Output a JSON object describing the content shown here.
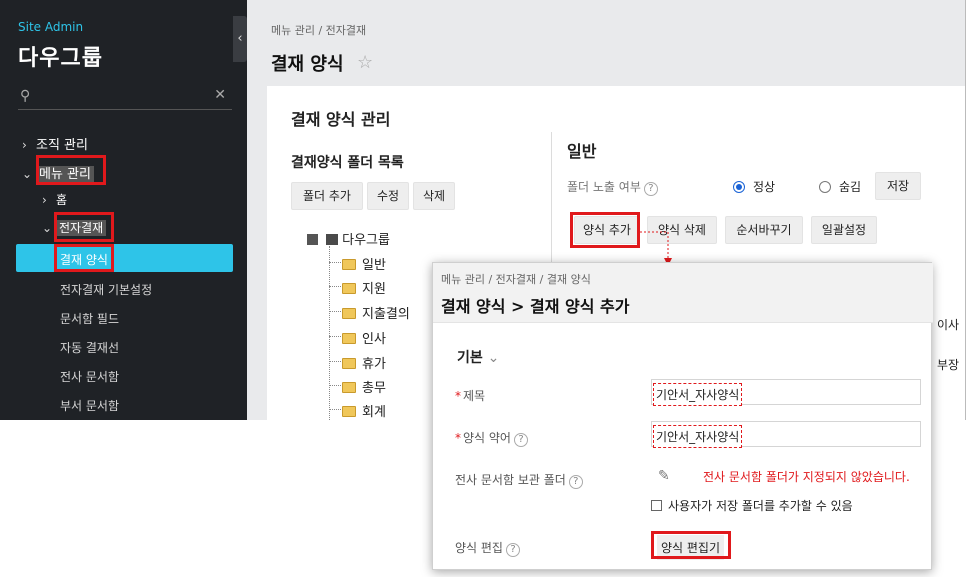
{
  "sidebar": {
    "site_label": "Site Admin",
    "company": "다우그룹",
    "search_placeholder": "",
    "menu": [
      {
        "label": "조직 관리"
      },
      {
        "label": "메뉴 관리"
      },
      {
        "label": "홈"
      },
      {
        "label": "전자결재"
      }
    ],
    "submenu": [
      {
        "label": "결재 양식",
        "active": true
      },
      {
        "label": "전자결재 기본설정"
      },
      {
        "label": "문서함 필드"
      },
      {
        "label": "자동 결재선"
      },
      {
        "label": "전사 문서함"
      },
      {
        "label": "부서 문서함"
      }
    ]
  },
  "header": {
    "breadcrumb": "메뉴 관리 / 전자결재",
    "title": "결재 양식"
  },
  "panel": {
    "title": "결재 양식 관리",
    "folder_list_title": "결재양식 폴더 목록",
    "folder_buttons": [
      "폴더 추가",
      "수정",
      "삭제"
    ],
    "tree_root": "다우그룹",
    "tree_items": [
      "일반",
      "지원",
      "지출결의",
      "인사",
      "휴가",
      "총무",
      "회계"
    ],
    "general_title": "일반",
    "folder_visibility_label": "폴더 노출 여부",
    "radio_normal": "정상",
    "radio_hidden": "숨김",
    "save_button": "저장",
    "form_buttons": [
      "양식 추가",
      "양식 삭제",
      "순서바꾸기",
      "일괄설정"
    ],
    "right_peek": [
      "이사",
      "부장"
    ]
  },
  "popup": {
    "breadcrumb": "메뉴 관리 / 전자결재 / 결재 양식",
    "title": "결재 양식 > 결재 양식 추가",
    "section": "기본",
    "name_label": "제목",
    "name_value": "기안서_자사양식",
    "abbr_label": "양식 약어",
    "abbr_value": "기안서_자사양식",
    "archive_label": "전사 문서함 보관 폴더",
    "archive_warning": "전사 문서함 폴더가 지정되지 않았습니다.",
    "allow_user_folder": "사용자가 저장 폴더를 추가할 수 있음",
    "editor_label": "양식 편집",
    "editor_button": "양식 편집기"
  },
  "colors": {
    "sidebar_bg": "#1f2226",
    "accent": "#2ec4e8",
    "highlight_border": "#e0191c",
    "radio_on": "#1a63d6"
  }
}
